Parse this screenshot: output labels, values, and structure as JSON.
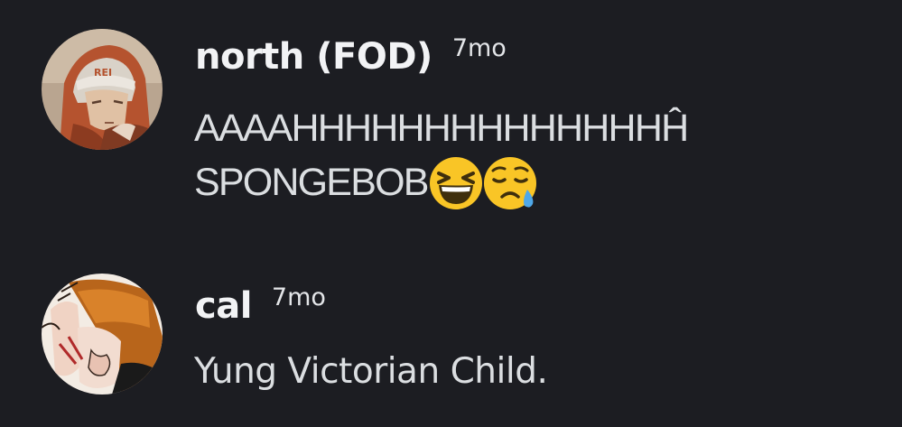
{
  "messages": [
    {
      "author": "north (FOD)",
      "timestamp": "7mo",
      "lines": [
        "AAAAHHHHHHHHHHHHHHĤ",
        "SPONGEBOB"
      ],
      "emojis": [
        "grinning-squinting-face",
        "sad-but-relieved-face"
      ],
      "avatar": "avatar-north"
    },
    {
      "author": "cal",
      "timestamp": "7mo",
      "lines": [
        "Yung Victorian Child."
      ],
      "avatar": "avatar-cal"
    }
  ],
  "colors": {
    "background": "#1c1d22",
    "username": "#f2f3f5",
    "message_text": "#dbdee1",
    "timestamp": "#e3e5e8"
  }
}
